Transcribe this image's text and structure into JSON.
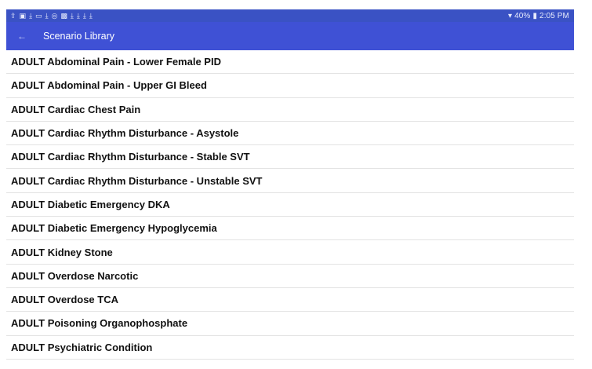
{
  "status_bar": {
    "notification_icons": [
      "upload-icon",
      "image-icon",
      "download-icon",
      "cast-icon",
      "download-icon",
      "target-icon",
      "gallery-icon",
      "download-icon",
      "download-icon",
      "download-icon",
      "download-icon"
    ],
    "battery": "40%",
    "time": "2:05 PM"
  },
  "app_bar": {
    "title": "Scenario Library",
    "back_icon": "arrow-left-icon",
    "color": "#3f51d5"
  },
  "scenarios": [
    "ADULT Abdominal Pain - Lower Female PID",
    "ADULT Abdominal Pain - Upper GI Bleed",
    "ADULT Cardiac Chest Pain",
    "ADULT Cardiac Rhythm Disturbance - Asystole",
    "ADULT Cardiac Rhythm Disturbance - Stable SVT",
    "ADULT Cardiac Rhythm Disturbance - Unstable SVT",
    "ADULT Diabetic Emergency DKA",
    "ADULT Diabetic Emergency Hypoglycemia",
    "ADULT Kidney Stone",
    "ADULT Overdose Narcotic",
    "ADULT Overdose TCA",
    "ADULT Poisoning Organophosphate",
    "ADULT Psychiatric Condition"
  ]
}
